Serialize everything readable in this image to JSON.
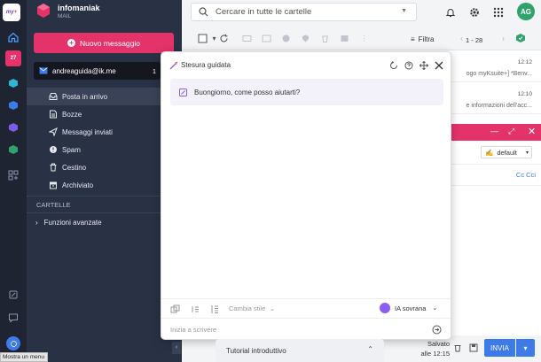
{
  "colors": {
    "accent": "#e4336a",
    "sidebar_bg": "#293145",
    "rail_bg": "#1f2433",
    "avatar_bg": "#2fa36b",
    "ai_purple": "#8b5cf6"
  },
  "brand": {
    "name": "infomaniak",
    "sub": "MAIL"
  },
  "rail": {
    "badge": "27",
    "icons": [
      "mykSuite-logo-icon",
      "home-icon",
      "mail-icon",
      "kdrive-icon",
      "kchat-icon",
      "contacts-icon",
      "calendar-icon",
      "more-apps-icon",
      "settings-device-icon",
      "feedback-icon",
      "help-icon"
    ]
  },
  "sidebar": {
    "new_message": "Nuovo messaggio",
    "account": {
      "email": "andreaguida@ik.me",
      "count": "1"
    },
    "folders": [
      {
        "label": "Posta in arrivo",
        "icon": "inbox-icon"
      },
      {
        "label": "Bozze",
        "icon": "drafts-icon"
      },
      {
        "label": "Messaggi inviati",
        "icon": "sent-icon"
      },
      {
        "label": "Spam",
        "icon": "spam-icon"
      },
      {
        "label": "Cestino",
        "icon": "trash-icon"
      },
      {
        "label": "Archiviato",
        "icon": "archive-icon"
      }
    ],
    "folders_section": "CARTELLE",
    "advanced": "Funzioni avanzate"
  },
  "header": {
    "search_placeholder": "Cercare in tutte le cartelle",
    "avatar": "AG"
  },
  "toolbar": {
    "filter": "Filtra",
    "pagination": "1 - 28"
  },
  "mails": [
    {
      "time": "12:12",
      "preview": "ogo myKsuite+]   *Benv..."
    },
    {
      "time": "12:10",
      "preview": "e informazioni dell'acc..."
    }
  ],
  "composer": {
    "signature": "default",
    "cc": "Cc Cci",
    "saved_line1": "Salvato",
    "saved_line2": "alle 12:15",
    "send": "INVIA"
  },
  "dialog": {
    "title": "Stesura guidata",
    "greeting": "Buongiorno, come posso aiutarti?",
    "style": "Cambia stile",
    "ai": "IA sovrana",
    "input_placeholder": "Inizia a scrivere"
  },
  "tutorial": "Tutorial introduttivo",
  "tooltip": "Mostra un menu"
}
